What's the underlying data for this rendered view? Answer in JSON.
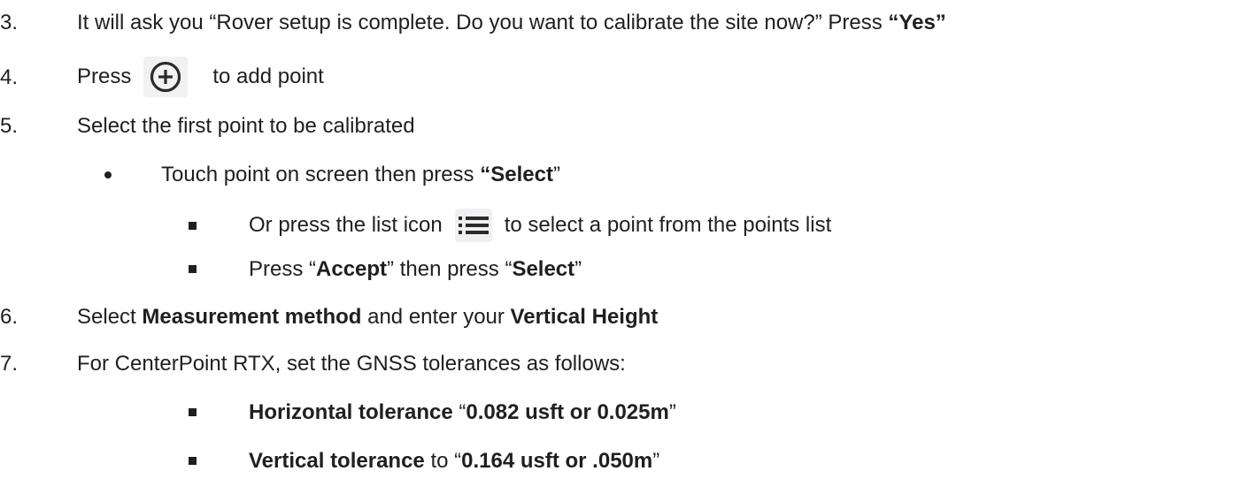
{
  "steps": {
    "s3": {
      "num": "3.",
      "text_a": "It will ask you “Rover setup is complete. Do you want to calibrate the site now?” Press ",
      "bold_a": "“Yes”"
    },
    "s4": {
      "num": "4.",
      "text_a": "Press",
      "text_b": "to add point"
    },
    "s5": {
      "num": "5.",
      "text_a": "Select the first point to be calibrated"
    },
    "s5_bullet": {
      "text_a": "Touch point on screen then press ",
      "bold_a": "“Select",
      "text_b": "”"
    },
    "s5_sub1": {
      "text_a": "Or press the list icon",
      "text_b": "to select a point from the points list"
    },
    "s5_sub2": {
      "text_a": "Press “",
      "bold_a": "Accept",
      "text_b": "” then press “",
      "bold_b": "Select",
      "text_c": "”"
    },
    "s6": {
      "num": "6.",
      "text_a": "Select ",
      "bold_a": "Measurement method",
      "text_b": " and enter your ",
      "bold_b": "Vertical Height"
    },
    "s7": {
      "num": "7.",
      "text_a": "For CenterPoint RTX, set the GNSS tolerances as follows:"
    },
    "s7_sub1": {
      "bold_a": "Horizontal tolerance",
      "text_a": " “",
      "bold_b": "0.082 usft or 0.025m",
      "text_b": "”"
    },
    "s7_sub2": {
      "bold_a": "Vertical tolerance",
      "text_a": " to “",
      "bold_b": "0.164 usft or .050m",
      "text_b": "”"
    }
  },
  "icons": {
    "add": "plus-circle-icon",
    "list": "list-icon"
  },
  "colors": {
    "text": "#1f1f1f",
    "icon_bg": "#f1f1f1"
  }
}
